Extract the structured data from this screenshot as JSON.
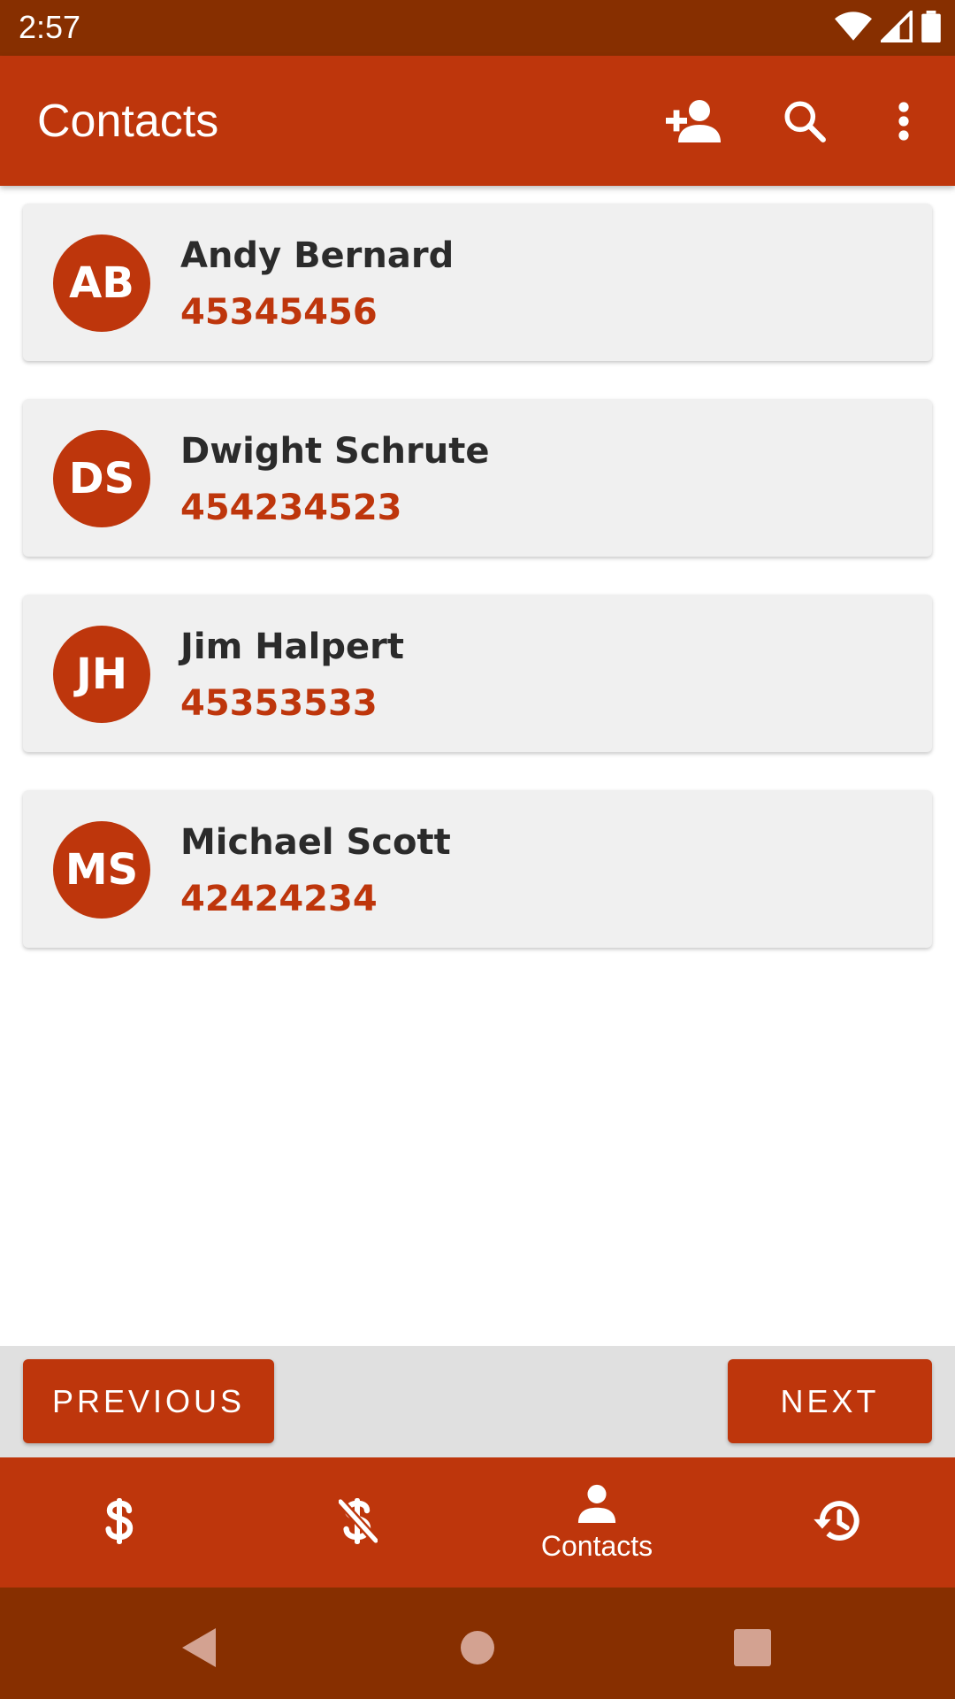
{
  "status_bar": {
    "time": "2:57",
    "icons": [
      "wifi-icon",
      "signal-icon",
      "battery-icon"
    ]
  },
  "app_bar": {
    "title": "Contacts",
    "actions": [
      "add-contact-icon",
      "search-icon",
      "more-vert-icon"
    ]
  },
  "contacts": [
    {
      "initials": "AB",
      "name": "Andy Bernard",
      "phone": "45345456"
    },
    {
      "initials": "DS",
      "name": "Dwight Schrute",
      "phone": "454234523"
    },
    {
      "initials": "JH",
      "name": "Jim Halpert",
      "phone": "45353533"
    },
    {
      "initials": "MS",
      "name": "Michael Scott",
      "phone": "42424234"
    }
  ],
  "pager": {
    "previous_label": "PREVIOUS",
    "next_label": "NEXT"
  },
  "bottom_nav": {
    "items": [
      {
        "icon": "dollar-icon",
        "label": ""
      },
      {
        "icon": "money-off-icon",
        "label": ""
      },
      {
        "icon": "person-icon",
        "label": "Contacts",
        "active": true
      },
      {
        "icon": "history-icon",
        "label": ""
      }
    ]
  },
  "colors": {
    "primary": "#be360c",
    "primary_dark": "#872f00",
    "card_bg": "#f0f0f0",
    "pager_bg": "#e0e0e0"
  }
}
